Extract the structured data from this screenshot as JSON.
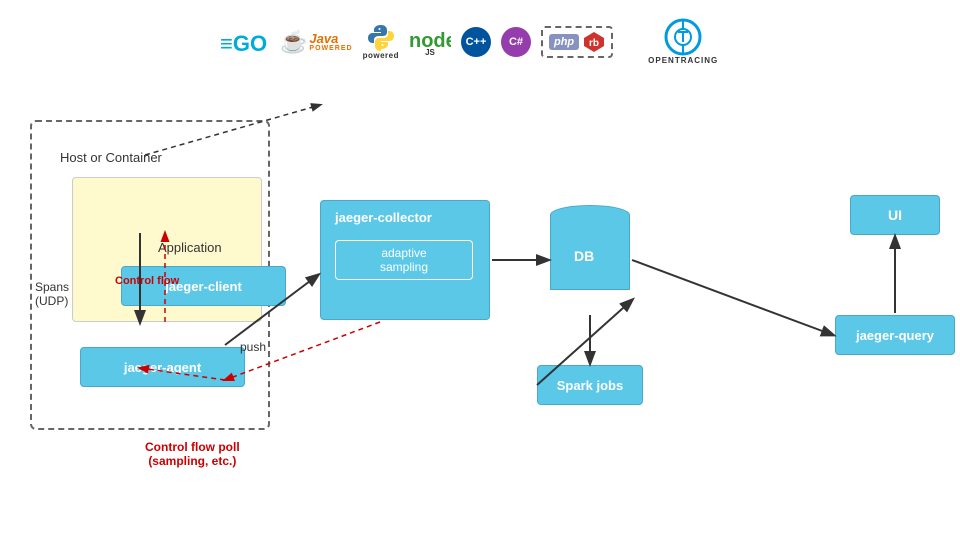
{
  "logos": {
    "go": "GO",
    "java": "Java",
    "java_subtitle": "POWERED",
    "python": "python",
    "node": "node",
    "node_subtitle": "JS",
    "cpp": "C++",
    "csharp": "C#",
    "php": "php",
    "opentracing": "OPENTRACING"
  },
  "diagram": {
    "host_label": "Host or Container",
    "app_label": "Application",
    "client_label": "jaeger-client",
    "agent_label": "jaeger-agent",
    "collector_label": "jaeger-collector",
    "sampling_label": "adaptive\nsampling",
    "db_label": "DB",
    "spark_label": "Spark jobs",
    "ui_label": "UI",
    "query_label": "jaeger-query",
    "spans_label": "Spans\n(UDP)",
    "control_flow_label": "Control flow",
    "push_label": "push",
    "poll_label": "Control flow poll\n(sampling, etc.)"
  }
}
